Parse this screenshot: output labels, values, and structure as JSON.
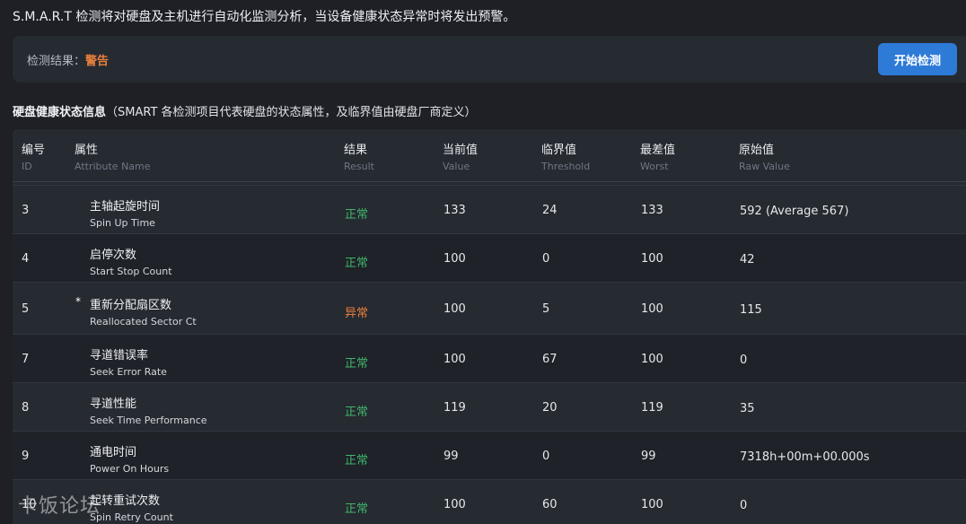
{
  "intro": "S.M.A.R.T 检测将对硬盘及主机进行自动化监测分析，当设备健康状态异常时将发出预警。",
  "result": {
    "label": "检测结果：",
    "value": "警告"
  },
  "start_button": "开始检测",
  "section": {
    "title": "硬盘健康状态信息",
    "note": "（SMART 各检测项目代表硬盘的状态属性，及临界值由硬盘厂商定义）"
  },
  "columns": [
    {
      "zh": "编号",
      "en": "ID"
    },
    {
      "zh": "属性",
      "en": "Attribute Name"
    },
    {
      "zh": "结果",
      "en": "Result"
    },
    {
      "zh": "当前值",
      "en": "Value"
    },
    {
      "zh": "临界值",
      "en": "Threshold"
    },
    {
      "zh": "最差值",
      "en": "Worst"
    },
    {
      "zh": "原始值",
      "en": "Raw Value"
    }
  ],
  "rows": [
    {
      "id": "3",
      "star": "",
      "name_zh": "主轴起旋时间",
      "name_en": "Spin Up Time",
      "result": "正常",
      "status": "ok",
      "value": "133",
      "threshold": "24",
      "worst": "133",
      "raw": "592 (Average 567)"
    },
    {
      "id": "4",
      "star": "",
      "name_zh": "启停次数",
      "name_en": "Start Stop Count",
      "result": "正常",
      "status": "ok",
      "value": "100",
      "threshold": "0",
      "worst": "100",
      "raw": "42"
    },
    {
      "id": "5",
      "star": "*",
      "name_zh": "重新分配扇区数",
      "name_en": "Reallocated Sector Ct",
      "result": "异常",
      "status": "bad",
      "value": "100",
      "threshold": "5",
      "worst": "100",
      "raw": "115"
    },
    {
      "id": "7",
      "star": "",
      "name_zh": "寻道错误率",
      "name_en": "Seek Error Rate",
      "result": "正常",
      "status": "ok",
      "value": "100",
      "threshold": "67",
      "worst": "100",
      "raw": "0"
    },
    {
      "id": "8",
      "star": "",
      "name_zh": "寻道性能",
      "name_en": "Seek Time Performance",
      "result": "正常",
      "status": "ok",
      "value": "119",
      "threshold": "20",
      "worst": "119",
      "raw": "35"
    },
    {
      "id": "9",
      "star": "",
      "name_zh": "通电时间",
      "name_en": "Power On Hours",
      "result": "正常",
      "status": "ok",
      "value": "99",
      "threshold": "0",
      "worst": "99",
      "raw": "7318h+00m+00.000s"
    },
    {
      "id": "10",
      "star": "",
      "name_zh": "起转重试次数",
      "name_en": "Spin Retry Count",
      "result": "正常",
      "status": "ok",
      "value": "100",
      "threshold": "60",
      "worst": "100",
      "raw": "0"
    }
  ],
  "watermark": "卡饭论坛",
  "colors": {
    "ok": "#3fb56b",
    "bad": "#e8803c",
    "accent": "#2d7ad7"
  }
}
